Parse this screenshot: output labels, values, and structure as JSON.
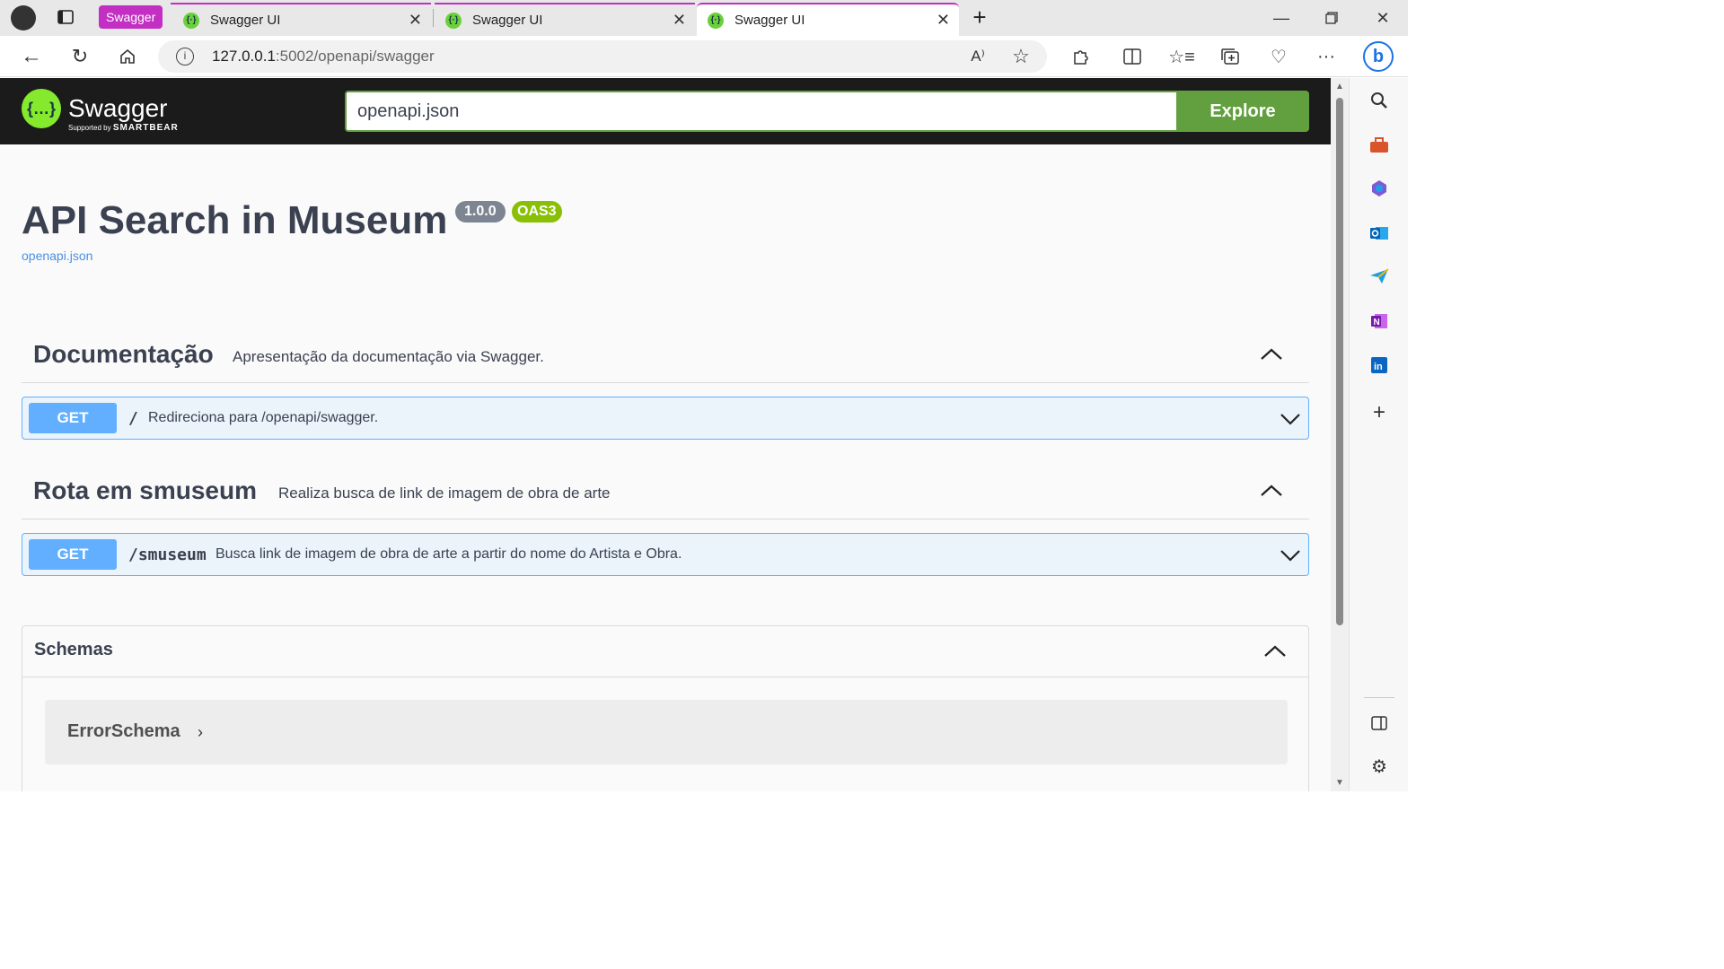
{
  "browser": {
    "tab_group_label": "Swagger",
    "tabs": [
      {
        "title": "Swagger UI"
      },
      {
        "title": "Swagger UI"
      },
      {
        "title": "Swagger UI"
      }
    ],
    "url_host": "127.0.0.1",
    "url_rest": ":5002/openapi/swagger",
    "read_aloud_label": "A⁾"
  },
  "swagger": {
    "logo_name": "Swagger",
    "logo_sub_prefix": "Supported by",
    "logo_sub_brand": "SMARTBEAR",
    "logo_glyph": "{…}",
    "search_value": "openapi.json",
    "explore_label": "Explore"
  },
  "info": {
    "title": "API Search in Museum",
    "version": "1.0.0",
    "oas": "OAS3",
    "spec_link": "openapi.json"
  },
  "tags": [
    {
      "name": "Documentação",
      "description": "Apresentação da documentação via Swagger.",
      "operations": [
        {
          "method": "GET",
          "path": "/",
          "summary": "Redireciona para /openapi/swagger."
        }
      ]
    },
    {
      "name": "Rota em smuseum",
      "description": "Realiza busca de link de imagem de obra de arte",
      "operations": [
        {
          "method": "GET",
          "path": "/smuseum",
          "summary": "Busca link de imagem de obra de arte a partir do nome do Artista e Obra."
        }
      ]
    }
  ],
  "schemas": {
    "title": "Schemas",
    "models": [
      {
        "name": "ErrorSchema"
      }
    ]
  },
  "colors": {
    "get_method": "#61affe",
    "explore": "#62a03f",
    "tab_accent": "#c22fc2"
  }
}
